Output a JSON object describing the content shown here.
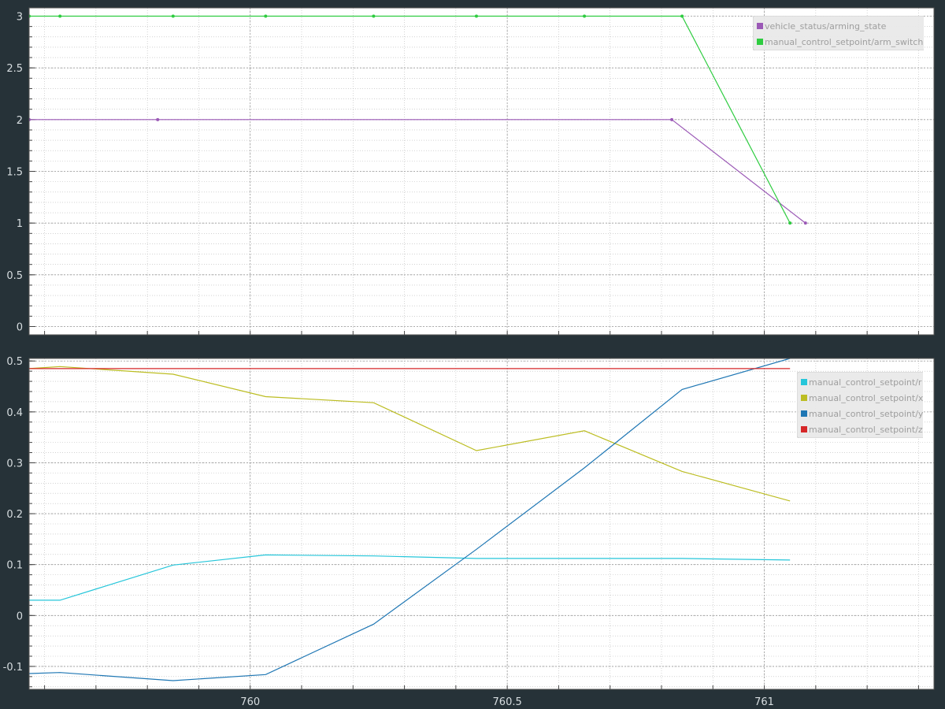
{
  "chart_data": [
    {
      "type": "line",
      "title": "",
      "xlabel": "",
      "ylabel": "",
      "xlim": [
        759.57,
        761.33
      ],
      "ylim": [
        -0.08,
        3.08
      ],
      "x_ticks": [
        760,
        760.5,
        761
      ],
      "x_tick_labels": [
        "760",
        "760.5",
        "761"
      ],
      "y_ticks": [
        0,
        0.5,
        1,
        1.5,
        2,
        2.5,
        3
      ],
      "y_tick_labels": [
        "0",
        "0.5",
        "1",
        "1.5",
        "2",
        "2.5",
        "3"
      ],
      "grid": true,
      "legend_position": "top-right",
      "series": [
        {
          "name": "vehicle_status/arming_state",
          "color": "#9b59b6",
          "markers": true,
          "x": [
            759.57,
            759.82,
            760.82,
            761.08
          ],
          "y": [
            2,
            2,
            2,
            1
          ]
        },
        {
          "name": "manual_control_setpoint/arm_switch",
          "color": "#2ecc40",
          "markers": true,
          "x": [
            759.57,
            759.63,
            759.85,
            760.03,
            760.24,
            760.44,
            760.65,
            760.84,
            761.05
          ],
          "y": [
            3,
            3,
            3,
            3,
            3,
            3,
            3,
            3,
            1
          ]
        }
      ]
    },
    {
      "type": "line",
      "title": "",
      "xlabel": "",
      "ylabel": "",
      "xlim": [
        759.57,
        761.33
      ],
      "ylim": [
        -0.145,
        0.505
      ],
      "x_ticks": [
        760,
        760.5,
        761
      ],
      "x_tick_labels": [
        "760",
        "760.5",
        "761"
      ],
      "y_ticks": [
        -0.1,
        0,
        0.1,
        0.2,
        0.3,
        0.4,
        0.5
      ],
      "y_tick_labels": [
        "-0.1",
        "0",
        "0.1",
        "0.2",
        "0.3",
        "0.4",
        "0.5"
      ],
      "grid": true,
      "legend_position": "top-right",
      "series": [
        {
          "name": "manual_control_setpoint/r",
          "color": "#26c6da",
          "markers": false,
          "x": [
            759.57,
            759.63,
            759.85,
            760.03,
            760.24,
            760.44,
            760.65,
            760.84,
            761.05
          ],
          "y": [
            0.03,
            0.03,
            0.099,
            0.119,
            0.117,
            0.112,
            0.112,
            0.112,
            0.109
          ]
        },
        {
          "name": "manual_control_setpoint/x",
          "color": "#bcbd22",
          "markers": false,
          "x": [
            759.57,
            759.63,
            759.85,
            760.03,
            760.24,
            760.44,
            760.65,
            760.84,
            761.05
          ],
          "y": [
            0.485,
            0.489,
            0.474,
            0.43,
            0.418,
            0.324,
            0.363,
            0.283,
            0.225
          ]
        },
        {
          "name": "manual_control_setpoint/y",
          "color": "#1f77b4",
          "markers": false,
          "x": [
            759.57,
            759.63,
            759.85,
            760.03,
            760.24,
            760.44,
            760.65,
            760.84,
            761.05
          ],
          "y": [
            -0.114,
            -0.112,
            -0.128,
            -0.116,
            -0.017,
            0.13,
            0.29,
            0.444,
            0.505
          ]
        },
        {
          "name": "manual_control_setpoint/z",
          "color": "#d62728",
          "markers": false,
          "x": [
            759.57,
            761.05
          ],
          "y": [
            0.485,
            0.485
          ]
        }
      ]
    }
  ]
}
